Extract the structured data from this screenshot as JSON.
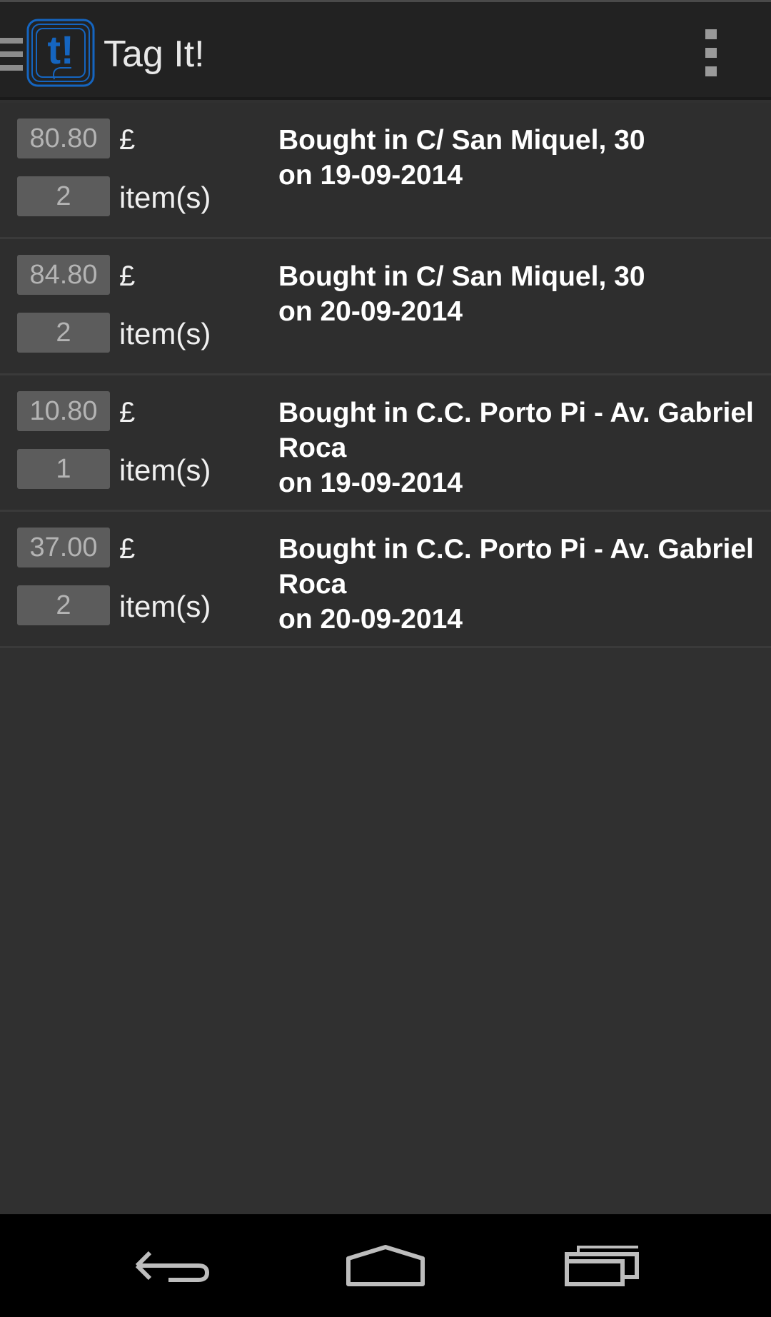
{
  "app": {
    "title": "Tag It!",
    "logo_text": "t!",
    "accent": "#1565c0"
  },
  "action_bar": {
    "drawer_icon": "hamburger-menu-icon",
    "overflow_icon": "more-vert-icon"
  },
  "purchases": [
    {
      "price": "80.80",
      "currency": "£",
      "quantity": "2",
      "quantity_label": "item(s)",
      "place_line": "Bought in C/ San Miquel, 30",
      "date_line": "on 19-09-2014"
    },
    {
      "price": "84.80",
      "currency": "£",
      "quantity": "2",
      "quantity_label": "item(s)",
      "place_line": "Bought in C/ San Miquel, 30",
      "date_line": "on 20-09-2014"
    },
    {
      "price": "10.80",
      "currency": "£",
      "quantity": "1",
      "quantity_label": "item(s)",
      "place_line": "Bought in C.C. Porto Pi - Av. Gabriel Roca",
      "date_line": "on 19-09-2014"
    },
    {
      "price": "37.00",
      "currency": "£",
      "quantity": "2",
      "quantity_label": "item(s)",
      "place_line": "Bought in C.C. Porto Pi - Av. Gabriel Roca",
      "date_line": "on 20-09-2014"
    }
  ],
  "nav": {
    "back_icon": "back-icon",
    "home_icon": "home-icon",
    "recents_icon": "recent-apps-icon"
  }
}
